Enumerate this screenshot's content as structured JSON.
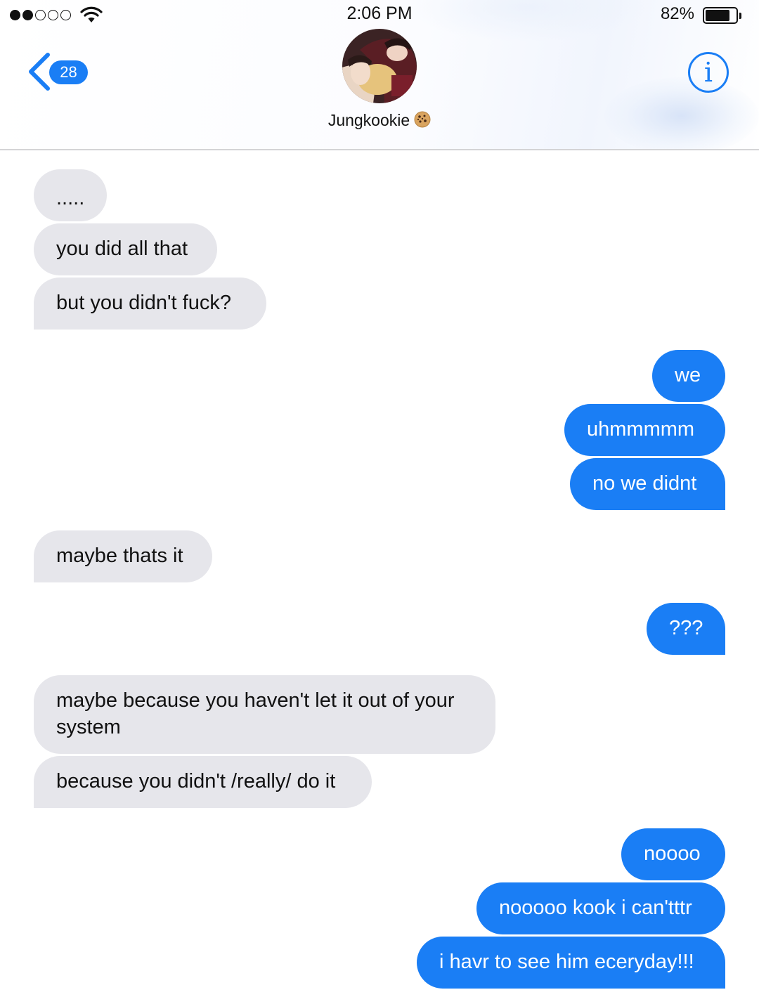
{
  "status_bar": {
    "time": "2:06 PM",
    "battery_percent": "82%",
    "battery_level": 0.82,
    "signal_strength": 2,
    "signal_max": 5
  },
  "header": {
    "back_count": "28",
    "contact_name": "Jungkookie",
    "contact_emoji": "cookie-icon",
    "info_glyph": "i"
  },
  "colors": {
    "accent": "#1a7ef5",
    "incoming_bubble": "#e6e6eb",
    "outgoing_bubble": "#1a7ef5"
  },
  "messages": [
    {
      "from": "them",
      "text": "....."
    },
    {
      "from": "them",
      "text": "you did all that"
    },
    {
      "from": "them",
      "text": "but you didn't fuck?"
    },
    {
      "from": "me",
      "text": "we"
    },
    {
      "from": "me",
      "text": "uhmmmmm"
    },
    {
      "from": "me",
      "text": "no we didnt"
    },
    {
      "from": "them",
      "text": "maybe thats it"
    },
    {
      "from": "me",
      "text": "???"
    },
    {
      "from": "them",
      "text": "maybe because you haven't let it out of your system"
    },
    {
      "from": "them",
      "text": "because you didn't /really/ do it"
    },
    {
      "from": "me",
      "text": "noooo"
    },
    {
      "from": "me",
      "text": "nooooo kook i can'tttr"
    },
    {
      "from": "me",
      "text": "i havr to see him eceryday!!!"
    }
  ]
}
